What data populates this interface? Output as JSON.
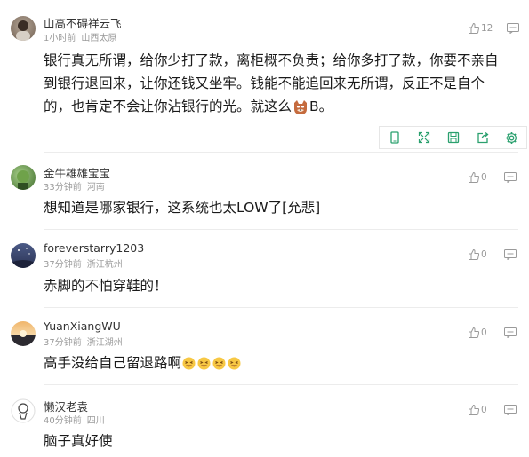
{
  "comments": [
    {
      "name": "山高不碍祥云飞",
      "time": "1小时前",
      "location": "山西太原",
      "likes": "12",
      "lines": [
        "银行真无所谓，给你少打了款，离柜概不负责；给你多打了款，你要不亲自",
        "到银行退回来，让你还钱又坐牢。钱能不能追回来无所谓，反正不是自个",
        "的，也肯定不会让你沾银行的光。就这么"
      ],
      "line3_tail": "B。",
      "emoji": "smirk-fox-emoji"
    },
    {
      "name": "金牛雄雄宝宝",
      "time": "33分钟前",
      "location": "河南",
      "likes": "0",
      "text": "想知道是哪家银行，这系统也太LOW了[允悲]"
    },
    {
      "name": "foreverstarry1203",
      "time": "37分钟前",
      "location": "浙江杭州",
      "likes": "0",
      "text": "赤脚的不怕穿鞋的！"
    },
    {
      "name": "YuanXiangWU",
      "time": "37分钟前",
      "location": "浙江湖州",
      "likes": "0",
      "text": "高手没给自己留退路啊",
      "trailing_emoji": [
        "laugh-emoji",
        "laugh-emoji",
        "laugh-emoji",
        "laugh-emoji"
      ]
    },
    {
      "name": "懒汉老袁",
      "time": "40分钟前",
      "location": "四川",
      "likes": "0",
      "text": "脑子真好使"
    }
  ],
  "toolbar": {
    "icons": [
      "phone-icon",
      "expand-icon",
      "save-icon",
      "share-icon",
      "settings-icon"
    ]
  },
  "colors": {
    "toolbar_icon": "#2aa06e",
    "meta": "#9a9a9a",
    "divider": "#ececec"
  }
}
